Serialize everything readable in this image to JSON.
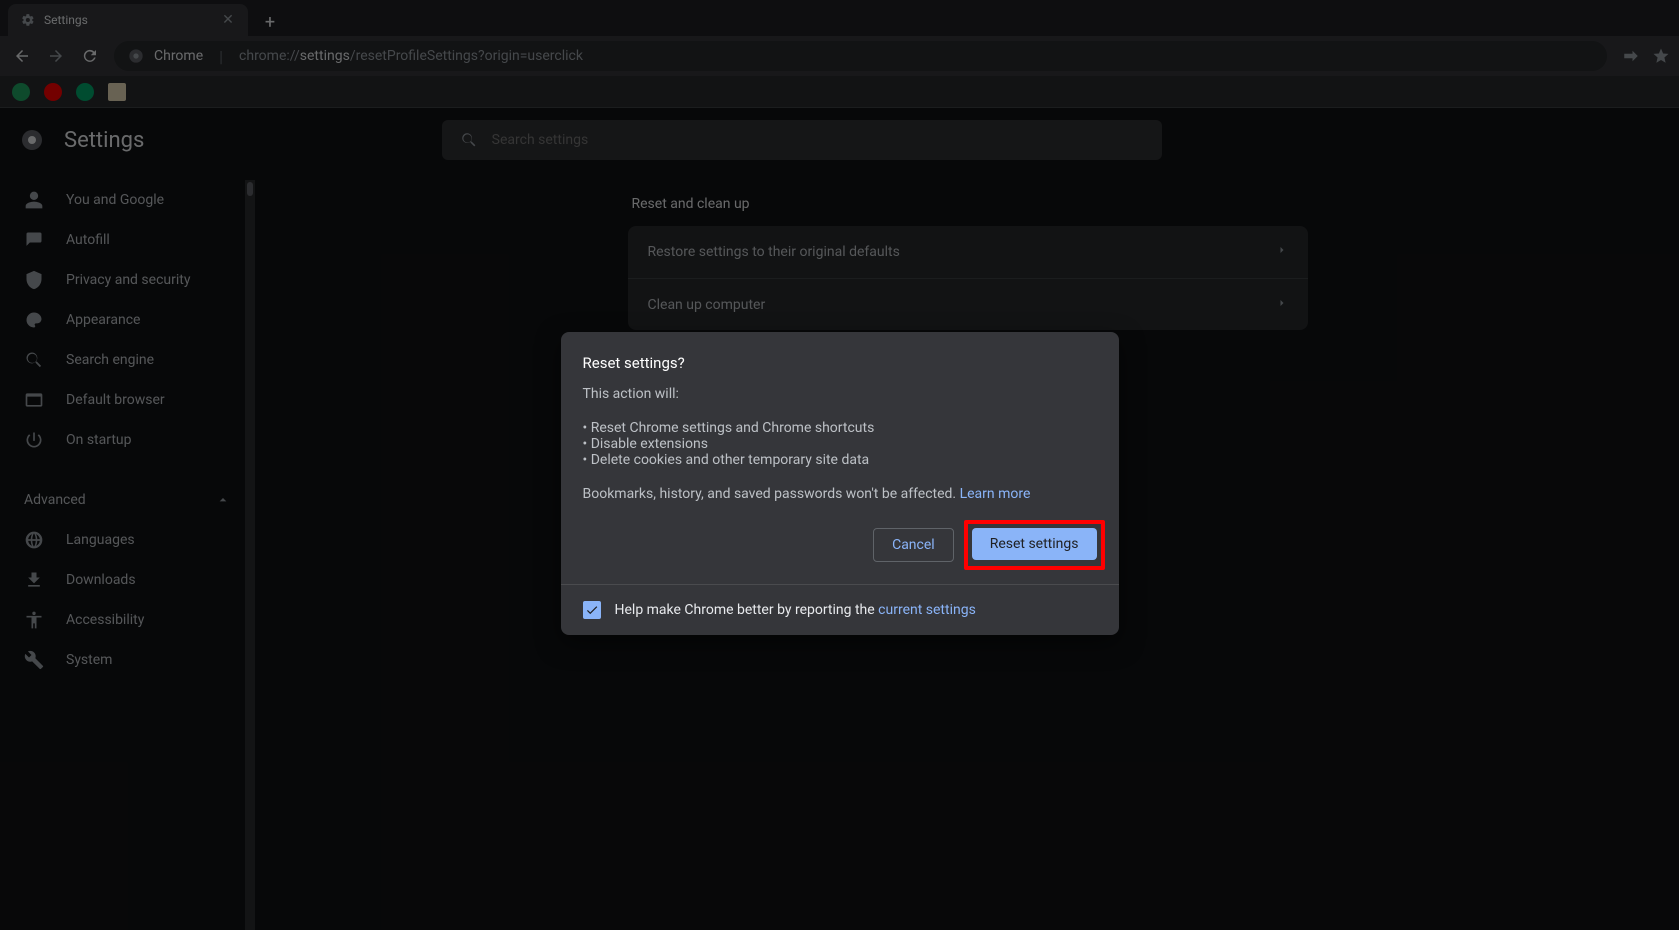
{
  "tab": {
    "title": "Settings"
  },
  "url": {
    "prefix": "Chrome",
    "pre": "chrome://",
    "bold": "settings",
    "rest": "/resetProfileSettings?origin=userclick"
  },
  "header": {
    "title": "Settings",
    "search_placeholder": "Search settings"
  },
  "sidebar": {
    "items": [
      {
        "label": "You and Google"
      },
      {
        "label": "Autofill"
      },
      {
        "label": "Privacy and security"
      },
      {
        "label": "Appearance"
      },
      {
        "label": "Search engine"
      },
      {
        "label": "Default browser"
      },
      {
        "label": "On startup"
      }
    ],
    "advanced": "Advanced",
    "advanced_items": [
      {
        "label": "Languages"
      },
      {
        "label": "Downloads"
      },
      {
        "label": "Accessibility"
      },
      {
        "label": "System"
      }
    ]
  },
  "main": {
    "section_title": "Reset and clean up",
    "rows": [
      {
        "label": "Restore settings to their original defaults"
      },
      {
        "label": "Clean up computer"
      }
    ]
  },
  "dialog": {
    "title": "Reset settings?",
    "subtitle": "This action will:",
    "bullets": [
      "Reset Chrome settings and Chrome shortcuts",
      "Disable extensions",
      "Delete cookies and other temporary site data"
    ],
    "note": "Bookmarks, history, and saved passwords won't be affected. ",
    "learn_more": "Learn more",
    "cancel": "Cancel",
    "confirm": "Reset settings",
    "footer_text": "Help make Chrome better by reporting the ",
    "footer_link": "current settings"
  }
}
